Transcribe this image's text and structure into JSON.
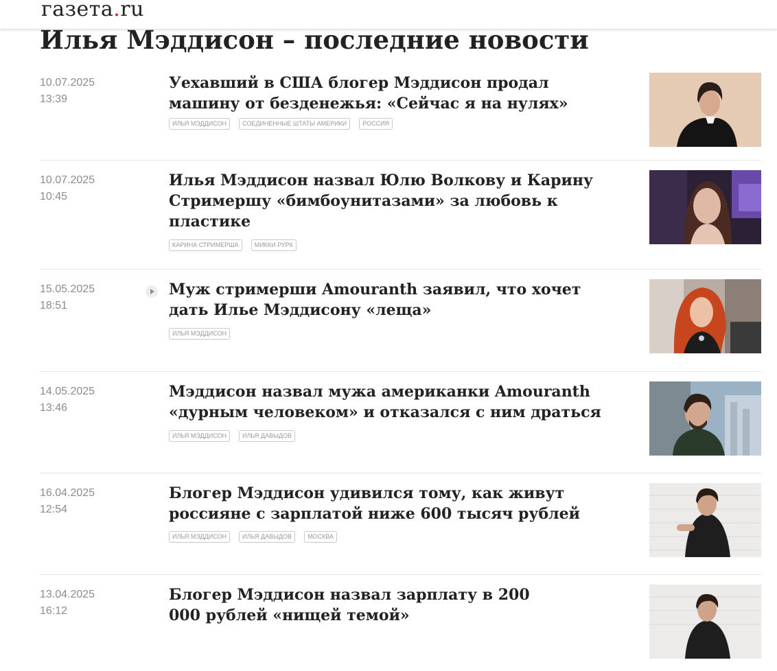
{
  "site": {
    "logo_main": "газета",
    "logo_dot": ".",
    "logo_tld": "ru",
    "accent_color": "#d6131b"
  },
  "page": {
    "title": "Илья Мэддисон – последние новости"
  },
  "articles": [
    {
      "date": "10.07.2025",
      "time": "13:39",
      "headline": "Уехавший в США блогер Мэддисон продал машину от безденежья: «Сейчас я на нулях»",
      "tags": [
        "Илья Мэддисон",
        "Соединенные Штаты Америки",
        "Россия"
      ],
      "has_video": false
    },
    {
      "date": "10.07.2025",
      "time": "10:45",
      "headline": "Илья Мэддисон назвал Юлю Волкову и Карину Стримершу «бимбоунитазами» за любовь к пластике",
      "tags": [
        "Карина Стримерша",
        "Микки Рурк"
      ],
      "has_video": false
    },
    {
      "date": "15.05.2025",
      "time": "18:51",
      "headline": "Муж стримерши Amouranth заявил, что хочет дать Илье Мэддисону «леща»",
      "tags": [
        "Илья Мэддисон"
      ],
      "has_video": true
    },
    {
      "date": "14.05.2025",
      "time": "13:46",
      "headline": "Мэддисон назвал мужа американки Amouranth «дурным человеком» и отказался с ним драться",
      "tags": [
        "Илья Мэддисон",
        "Илья Давыдов"
      ],
      "has_video": false
    },
    {
      "date": "16.04.2025",
      "time": "12:54",
      "headline": "Блогер Мэддисон удивился тому, как живут россияне с зарплатой ниже 600 тысяч рублей",
      "tags": [
        "Илья Мэддисон",
        "Илья Давыдов",
        "Москва"
      ],
      "has_video": false
    },
    {
      "date": "13.04.2025",
      "time": "16:12",
      "headline": "Блогер Мэддисон назвал зарплату в 200 000 рублей «нищей темой»",
      "tags": [],
      "has_video": false
    }
  ]
}
